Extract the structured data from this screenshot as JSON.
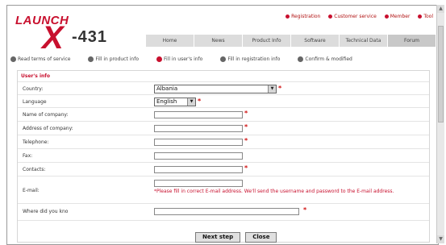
{
  "logo": {
    "launch": "LAUNCH",
    "x": "X",
    "model": "-431"
  },
  "top_links": [
    "Registration",
    "Customer service",
    "Member",
    "Tool"
  ],
  "nav_tabs": [
    "Home",
    "News",
    "Product Info",
    "Software",
    "Technical Data",
    "Forum"
  ],
  "steps": [
    {
      "label": "Read terms of service",
      "current": false
    },
    {
      "label": "Fill in product info",
      "current": false
    },
    {
      "label": "Fill in user's info",
      "current": true
    },
    {
      "label": "Fill in registration info",
      "current": false
    },
    {
      "label": "Confirm & modified",
      "current": false
    }
  ],
  "form": {
    "section_title": "User's info",
    "country": {
      "label": "Country:",
      "value": "Albania"
    },
    "language": {
      "label": "Language",
      "value": "English"
    },
    "company_name": {
      "label": "Name of company:"
    },
    "company_address": {
      "label": "Address of company:"
    },
    "telephone": {
      "label": "Telephone:"
    },
    "fax": {
      "label": "Fax:"
    },
    "contacts": {
      "label": "Contacts:"
    },
    "email": {
      "label": "E-mail:",
      "note": "*Please fill in correct E-mail address. We'll send the username and password to the E-mail address."
    },
    "source": {
      "label": "Where did you kno"
    }
  },
  "buttons": {
    "next": "Next step",
    "close": "Close"
  },
  "colors": {
    "brand": "#c8102e",
    "nav": "#dcdcdc"
  }
}
